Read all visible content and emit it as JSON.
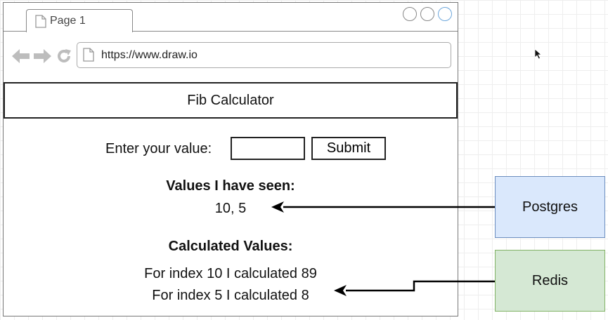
{
  "browser": {
    "tab_label": "Page 1",
    "url": "https://www.draw.io"
  },
  "app": {
    "title": "Fib Calculator",
    "input_label": "Enter your value:",
    "input_value": "",
    "submit_label": "Submit",
    "seen_heading": "Values I have seen:",
    "seen_values": "10, 5",
    "calculated_heading": "Calculated Values:",
    "calculated_lines": [
      "For index 10 I calculated 89",
      "For index 5 I calculated 8"
    ]
  },
  "boxes": {
    "postgres": {
      "label": "Postgres",
      "fill": "#dae8fc",
      "stroke": "#6c8ebf"
    },
    "redis": {
      "label": "Redis",
      "fill": "#d5e8d4",
      "stroke": "#82b366"
    }
  },
  "icons": [
    "page-icon",
    "back-arrow-icon",
    "forward-arrow-icon",
    "reload-icon",
    "cursor-icon"
  ]
}
